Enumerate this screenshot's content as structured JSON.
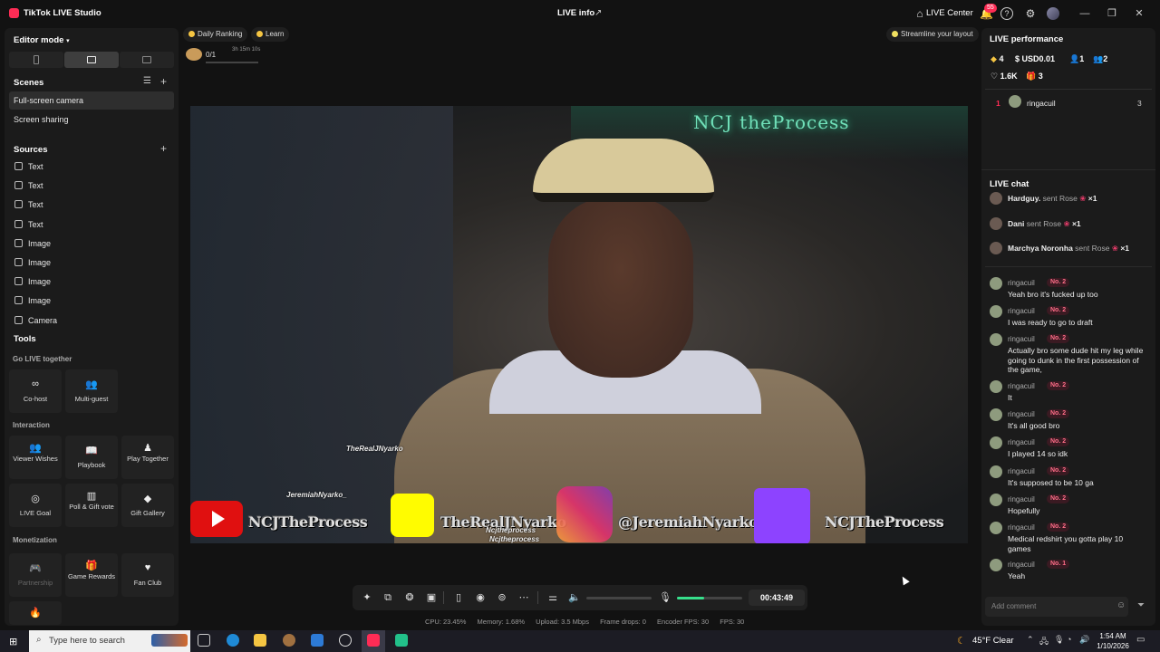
{
  "titlebar": {
    "app_title": "TikTok LIVE Studio",
    "center_title": "LIVE info",
    "live_center": "LIVE Center",
    "notification_count": "55",
    "icons": [
      "share-icon",
      "home-icon",
      "bell-icon",
      "help-icon",
      "gear-icon",
      "avatar",
      "minimize-icon",
      "maximize-icon",
      "close-icon"
    ]
  },
  "left": {
    "editor_mode": "Editor mode",
    "scenes_title": "Scenes",
    "scenes": [
      "Full-screen camera",
      "Screen sharing"
    ],
    "sources_title": "Sources",
    "sources": [
      {
        "label": "Text",
        "icon": "text-icon"
      },
      {
        "label": "Text",
        "icon": "text-icon"
      },
      {
        "label": "Text",
        "icon": "text-icon"
      },
      {
        "label": "Text",
        "icon": "text-icon"
      },
      {
        "label": "Image",
        "icon": "image-icon"
      },
      {
        "label": "Image",
        "icon": "image-icon"
      },
      {
        "label": "Image",
        "icon": "image-icon"
      },
      {
        "label": "Image",
        "icon": "image-icon"
      },
      {
        "label": "Camera",
        "icon": "camera-icon"
      }
    ],
    "tools_title": "Tools",
    "go_live_together": "Go LIVE together",
    "cohost": "Co-host",
    "multiguest": "Multi-guest",
    "interaction": "Interaction",
    "viewer_wishes": "Viewer Wishes",
    "playbook": "Playbook",
    "play_together": "Play Together",
    "live_goal": "LIVE Goal",
    "poll_gift": "Poll & Gift vote",
    "gift_gallery": "Gift Gallery",
    "monetization": "Monetization",
    "partnership": "Partnership",
    "game_rewards": "Game Rewards",
    "fan_club": "Fan Club"
  },
  "topstrip": {
    "daily_ranking": "Daily Ranking",
    "learn": "Learn",
    "progress": "0/1",
    "progress_time": "3h 15m 10s",
    "streamline": "Streamline your layout"
  },
  "video": {
    "neon_sign": "NCJ theProcess",
    "snap_handle_top": "TheRealJNyarko",
    "ig_handle_small": "JeremiahNyarko_",
    "yt_name": "NCJTheProcess",
    "snap_name": "TheRealJNyarko",
    "ig_name": "@JeremiahNyarko_",
    "tw_name": "NCJTheProcess",
    "tiktok_handle1": "Ncjtheprocess",
    "tiktok_handle2": "Ncjtheprocess"
  },
  "controls": {
    "timer": "00:43:49",
    "volume_level": 0.83,
    "stats": {
      "cpu": "CPU: 23.45%",
      "memory": "Memory: 1.68%",
      "upload": "Upload: 3.5 Mbps",
      "frame_drops": "Frame drops: 0",
      "encoder_fps": "Encoder FPS: 30",
      "fps": "FPS: 30"
    }
  },
  "right": {
    "performance_title": "LIVE performance",
    "diamonds": "4",
    "usd": "USD0.01",
    "viewers": "1",
    "new_followers": "2",
    "likes": "1.6K",
    "gifts": "3",
    "top_rank": "1",
    "top_user": "ringacuil",
    "top_score": "3",
    "chat_title": "LIVE chat",
    "gift_events": [
      {
        "user": "Hardguy.",
        "action": "sent Rose",
        "count": "×1"
      },
      {
        "user": "Dani",
        "action": "sent Rose",
        "count": "×1"
      },
      {
        "user": "Marchya Noronha",
        "action": "sent Rose",
        "count": "×1"
      }
    ],
    "messages": [
      {
        "user": "ringacuil",
        "rank": "No. 2",
        "text": "Yeah bro it's fucked up too"
      },
      {
        "user": "ringacuil",
        "rank": "No. 2",
        "text": "I was ready to go to draft"
      },
      {
        "user": "ringacuil",
        "rank": "No. 2",
        "text": "Actually bro some dude hit my leg while going to dunk in the first possession of the game,"
      },
      {
        "user": "ringacuil",
        "rank": "No. 2",
        "text": "It"
      },
      {
        "user": "ringacuil",
        "rank": "No. 2",
        "text": "It's all good bro"
      },
      {
        "user": "ringacuil",
        "rank": "No. 2",
        "text": "I played 14 so idk"
      },
      {
        "user": "ringacuil",
        "rank": "No. 2",
        "text": "It's supposed to be 10 ga"
      },
      {
        "user": "ringacuil",
        "rank": "No. 2",
        "text": "Hopefully"
      },
      {
        "user": "ringacuil",
        "rank": "No. 2",
        "text": "Medical redshirt you gotta play 10 games"
      },
      {
        "user": "ringacuil",
        "rank": "No. 1",
        "text": "Yeah"
      }
    ],
    "add_comment_placeholder": "Add comment"
  },
  "taskbar": {
    "search_placeholder": "Type here to search",
    "weather": "45°F  Clear",
    "time": "1:54 AM",
    "date": "1/10/2026"
  }
}
